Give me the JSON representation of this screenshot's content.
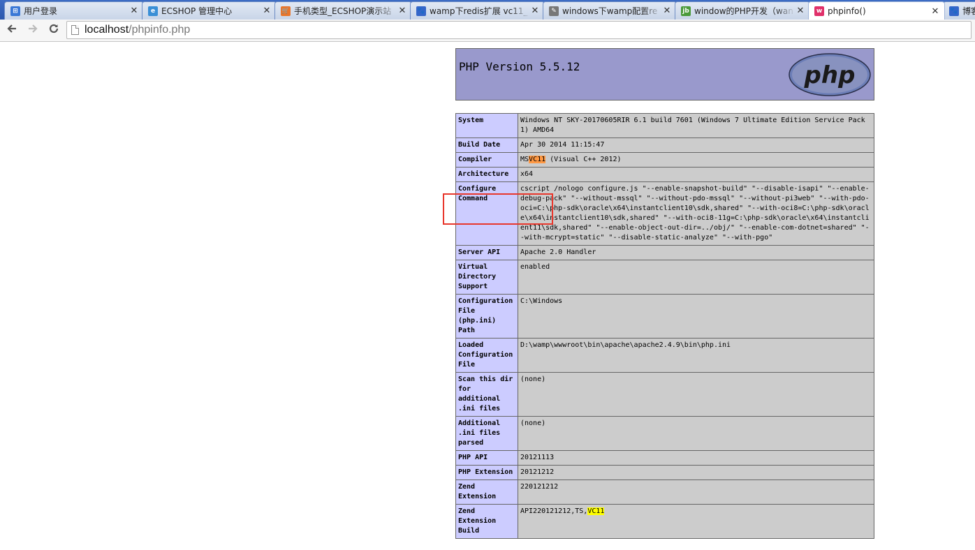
{
  "browser": {
    "tabs": [
      {
        "title": "用户登录",
        "favicon_color": "#3a78d6",
        "favicon_glyph": "⊞",
        "active": false
      },
      {
        "title": "ECSHOP 管理中心",
        "favicon_color": "#3a8fd6",
        "favicon_glyph": "e",
        "active": false
      },
      {
        "title": "手机类型_ECSHOP演示站",
        "favicon_color": "#e8762c",
        "favicon_glyph": "🛒",
        "active": false
      },
      {
        "title": "wamp下redis扩展 vc11_",
        "favicon_color": "#3466c9",
        "favicon_glyph": "🐾",
        "active": false
      },
      {
        "title": "windows下wamp配置re",
        "favicon_color": "#777777",
        "favicon_glyph": "✎",
        "active": false
      },
      {
        "title": "window的PHP开发（wan",
        "favicon_color": "#4a9a3a",
        "favicon_glyph": "jb",
        "active": false
      },
      {
        "title": "phpinfo()",
        "favicon_color": "#e0306a",
        "favicon_glyph": "w",
        "active": true
      },
      {
        "title": "博客",
        "favicon_color": "#3466c9",
        "favicon_glyph": "🐾",
        "active": false
      }
    ],
    "close_glyph": "✕",
    "back_icon": "arrow-left-icon",
    "forward_icon": "arrow-right-icon",
    "reload_icon": "reload-icon",
    "url_host": "localhost",
    "url_path": "/phpinfo.php"
  },
  "phpinfo": {
    "title": "PHP Version 5.5.12",
    "logo_text": "php",
    "rows": [
      {
        "key": "System",
        "value": "Windows NT SKY-20170605RIR 6.1 build 7601 (Windows 7 Ultimate Edition Service Pack 1) AMD64"
      },
      {
        "key": "Build Date",
        "value": "Apr 30 2014 11:15:47"
      },
      {
        "key": "Compiler",
        "value_pre": "MS",
        "value_hl": "VC11",
        "value_post": " (Visual C++ 2012)"
      },
      {
        "key": "Architecture",
        "value": "x64"
      },
      {
        "key": "Configure Command",
        "value": "cscript /nologo configure.js \"--enable-snapshot-build\" \"--disable-isapi\" \"--enable-debug-pack\" \"--without-mssql\" \"--without-pdo-mssql\" \"--without-pi3web\" \"--with-pdo-oci=C:\\php-sdk\\oracle\\x64\\instantclient10\\sdk,shared\" \"--with-oci8=C:\\php-sdk\\oracle\\x64\\instantclient10\\sdk,shared\" \"--with-oci8-11g=C:\\php-sdk\\oracle\\x64\\instantclient11\\sdk,shared\" \"--enable-object-out-dir=../obj/\" \"--enable-com-dotnet=shared\" \"--with-mcrypt=static\" \"--disable-static-analyze\" \"--with-pgo\""
      },
      {
        "key": "Server API",
        "value": "Apache 2.0 Handler"
      },
      {
        "key": "Virtual Directory Support",
        "value": "enabled"
      },
      {
        "key": "Configuration File (php.ini) Path",
        "value": "C:\\Windows"
      },
      {
        "key": "Loaded Configuration File",
        "value": "D:\\wamp\\wwwroot\\bin\\apache\\apache2.4.9\\bin\\php.ini"
      },
      {
        "key": "Scan this dir for additional .ini files",
        "value": "(none)"
      },
      {
        "key": "Additional .ini files parsed",
        "value": "(none)"
      },
      {
        "key": "PHP API",
        "value": "20121113"
      },
      {
        "key": "PHP Extension",
        "value": "20121212"
      },
      {
        "key": "Zend Extension",
        "value": "220121212"
      },
      {
        "key": "Zend Extension Build",
        "value_pre": "API220121212,TS,",
        "value_hl": "VC11",
        "value_post": ""
      }
    ]
  }
}
